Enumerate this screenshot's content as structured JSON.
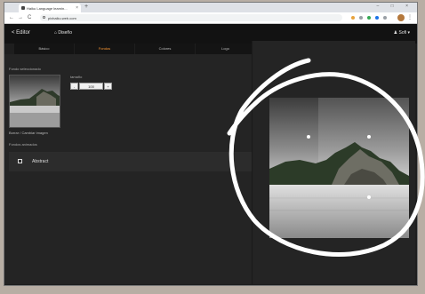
{
  "browser": {
    "tab_title": "Haiku Language learnin...",
    "tab_close": "×",
    "new_tab": "+",
    "url": "pixhaiku.web.com",
    "window_controls": "– □ ×",
    "nav_back": "←",
    "nav_forward": "→",
    "nav_reload": "C",
    "menu": "⋮",
    "extension_colors": [
      "#e8a33d",
      "#9aa0a6",
      "#34a853",
      "#1a73e8",
      "#9aa0a6"
    ]
  },
  "header": {
    "back_label": "< Editor",
    "view_label": "⌂ Diseño",
    "user_label": "♟ Sofi ▾"
  },
  "tabs": [
    {
      "label": "Básico"
    },
    {
      "label": "Fondos"
    },
    {
      "label": "Colores"
    },
    {
      "label": "Logo"
    }
  ],
  "sidebar": {
    "selected_bg_label": "Fondo seleccionado",
    "size_label": "tamaño",
    "size_minus": "-",
    "size_value": "100",
    "size_plus": "+",
    "change_link": "Borrar / Cambiar imagen",
    "effects_label": "Fondos animados",
    "abstract_label": "Abstract"
  },
  "colors": {
    "accent": "#ff9933",
    "app_bg": "#242424",
    "header_bg": "#121212"
  }
}
